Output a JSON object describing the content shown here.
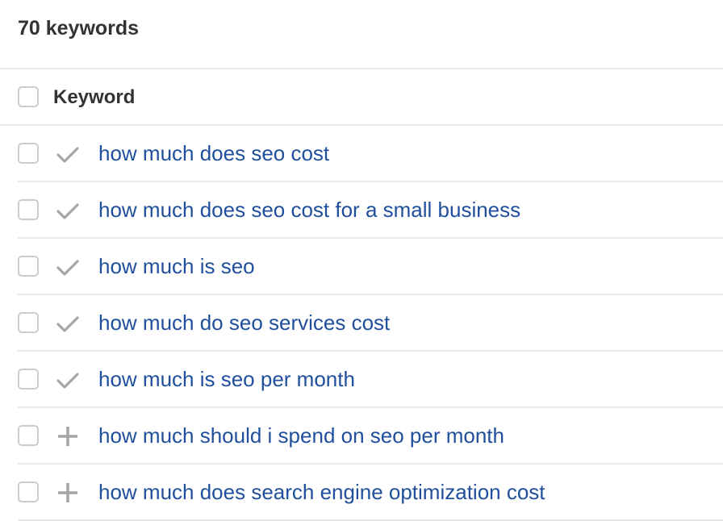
{
  "header": {
    "title": "70 keywords"
  },
  "table": {
    "column_header": "Keyword",
    "rows": [
      {
        "keyword": "how much does seo cost",
        "status_icon": "check-icon"
      },
      {
        "keyword": "how much does seo cost for a small business",
        "status_icon": "check-icon"
      },
      {
        "keyword": "how much is seo",
        "status_icon": "check-icon"
      },
      {
        "keyword": "how much do seo services cost",
        "status_icon": "check-icon"
      },
      {
        "keyword": "how much is seo per month",
        "status_icon": "check-icon"
      },
      {
        "keyword": "how much should i spend on seo per month",
        "status_icon": "plus-icon"
      },
      {
        "keyword": "how much does search engine optimization cost",
        "status_icon": "plus-icon"
      }
    ]
  },
  "colors": {
    "link": "#1f4f9d",
    "icon": "#a6a6a6",
    "text": "#333333"
  }
}
